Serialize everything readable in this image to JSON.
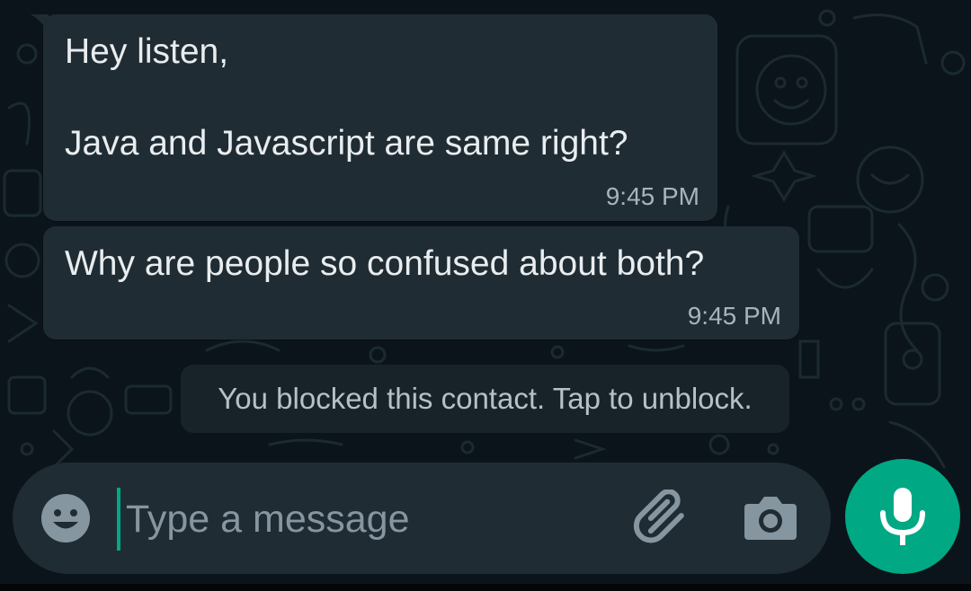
{
  "conversation": {
    "messages": [
      {
        "lines": [
          "Hey listen,",
          "",
          "Java and Javascript are same right?"
        ],
        "time": "9:45 PM"
      },
      {
        "lines": [
          "Why are people so confused about both?"
        ],
        "time": "9:45 PM"
      }
    ],
    "system_notice": "You blocked this contact. Tap to unblock."
  },
  "composer": {
    "placeholder": "Type a message",
    "value": ""
  },
  "icons": {
    "emoji": "emoji-icon",
    "attach": "paperclip-icon",
    "camera": "camera-icon",
    "mic": "microphone-icon"
  },
  "colors": {
    "background": "#0b141a",
    "bubble": "#202c33",
    "accent": "#00a884",
    "text": "#e9edef",
    "muted": "#8696a0"
  }
}
